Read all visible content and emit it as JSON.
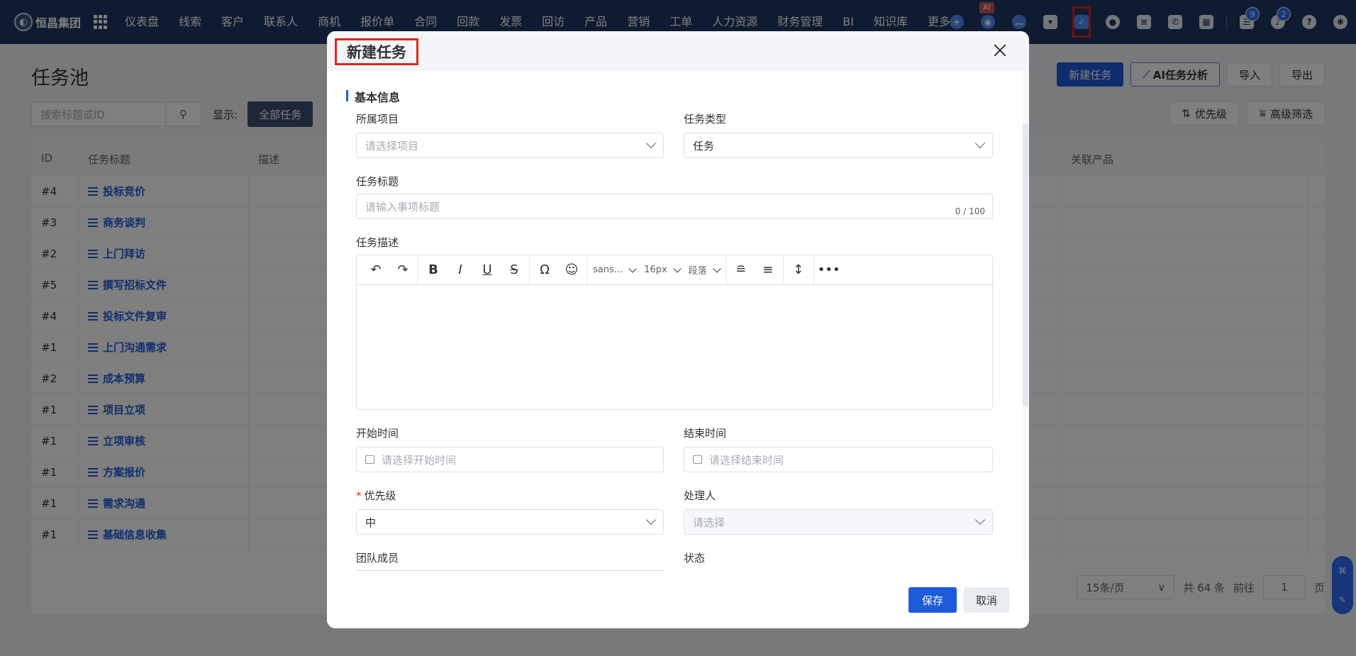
{
  "brand": {
    "name": "恒昌集团"
  },
  "nav": {
    "items": [
      "仪表盘",
      "线索",
      "客户",
      "联系人",
      "商机",
      "报价单",
      "合同",
      "回款",
      "发票",
      "回访",
      "产品",
      "营销",
      "工单",
      "人力资源",
      "财务管理",
      "BI",
      "知识库"
    ],
    "more": "更多",
    "ai_tag": "AI",
    "badge_tasks": "9",
    "badge_notifications": "2"
  },
  "page": {
    "title": "任务池",
    "buttons": {
      "new_task": "新建任务",
      "ai_analysis": "AI任务分析",
      "import": "导入",
      "export": "导出"
    },
    "search_placeholder": "搜索标题或ID",
    "filter_label": "显示:",
    "filter_all": "全部任务",
    "sort_priority": "优先级",
    "advanced_filter": "高级筛选"
  },
  "table": {
    "columns": {
      "id": "ID",
      "title": "任务标题",
      "desc": "描述",
      "product": "关联产品"
    },
    "rows": [
      {
        "id": "#4",
        "title": "投标竞价"
      },
      {
        "id": "#3",
        "title": "商务谈判"
      },
      {
        "id": "#2",
        "title": "上门拜访"
      },
      {
        "id": "#5",
        "title": "撰写招标文件"
      },
      {
        "id": "#4",
        "title": "投标文件复审"
      },
      {
        "id": "#1",
        "title": "上门沟通需求"
      },
      {
        "id": "#2",
        "title": "成本预算"
      },
      {
        "id": "#1",
        "title": "项目立项"
      },
      {
        "id": "#1",
        "title": "立项审核"
      },
      {
        "id": "#1",
        "title": "方案报价"
      },
      {
        "id": "#1",
        "title": "需求沟通"
      },
      {
        "id": "#1",
        "title": "基础信息收集"
      }
    ]
  },
  "pager": {
    "page_size": "15条/页",
    "total": "共 64 条",
    "goto": "前往",
    "page": "1",
    "page_unit": "页"
  },
  "dialog": {
    "title": "新建任务",
    "section_basic": "基本信息",
    "project_label": "所属项目",
    "project_placeholder": "请选择项目",
    "type_label": "任务类型",
    "type_value": "任务",
    "title_label": "任务标题",
    "title_placeholder": "请输入事项标题",
    "title_counter": "0 / 100",
    "desc_label": "任务描述",
    "editor": {
      "font": "sans...",
      "size": "16px",
      "block": "段落"
    },
    "start_label": "开始时间",
    "start_placeholder": "请选择开始时间",
    "end_label": "结束时间",
    "end_placeholder": "请选择结束时间",
    "priority_label": "优先级",
    "priority_value": "中",
    "assignee_label": "处理人",
    "assignee_placeholder": "请选择",
    "team_label": "团队成员",
    "status_label": "状态",
    "save": "保存",
    "cancel": "取消"
  },
  "colors": {
    "nav_bg": "#1f3660",
    "primary": "#1e5bdb",
    "highlight": "#e1261c"
  }
}
